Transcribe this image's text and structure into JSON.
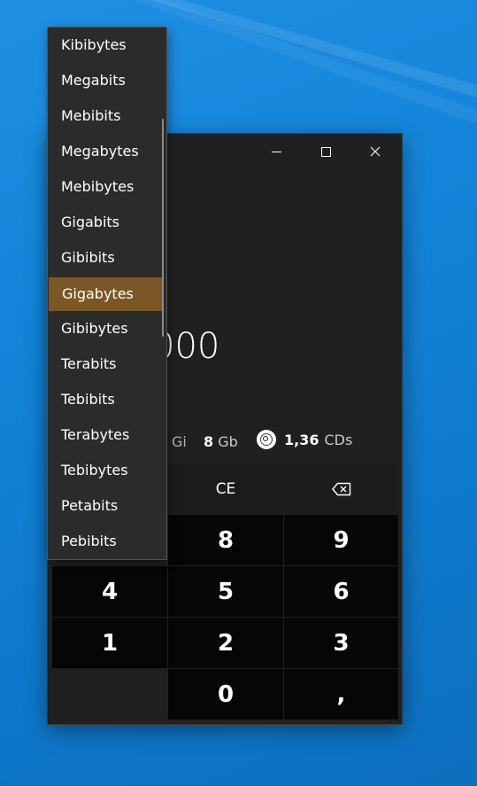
{
  "window": {
    "minimize_label": "",
    "maximize_label": "",
    "close_label": ""
  },
  "display": {
    "value": "000"
  },
  "equivalents": {
    "gi_unit": "Gi",
    "gb_value": "8",
    "gb_unit": "Gb",
    "cd_value": "1,36",
    "cd_unit": "CDs"
  },
  "keypad": {
    "ce": "CE",
    "backspace_icon": "backspace-icon",
    "digits": {
      "8": "8",
      "9": "9",
      "4": "4",
      "5": "5",
      "6": "6",
      "1": "1",
      "2": "2",
      "3": "3",
      "0": "0"
    },
    "decimal": ","
  },
  "unit_dropdown": {
    "items": [
      "Kibibytes",
      "Megabits",
      "Mebibits",
      "Megabytes",
      "Mebibytes",
      "Gigabits",
      "Gibibits",
      "Gigabytes",
      "Gibibytes",
      "Terabits",
      "Tebibits",
      "Terabytes",
      "Tebibytes",
      "Petabits",
      "Pebibits"
    ],
    "selected": "Gigabytes"
  },
  "colors": {
    "desktop": "#1384d9",
    "window_bg": "#202020",
    "key_bg": "#060606",
    "dropdown_bg": "#2b2b2b",
    "selected_accent": "#7a5725"
  }
}
